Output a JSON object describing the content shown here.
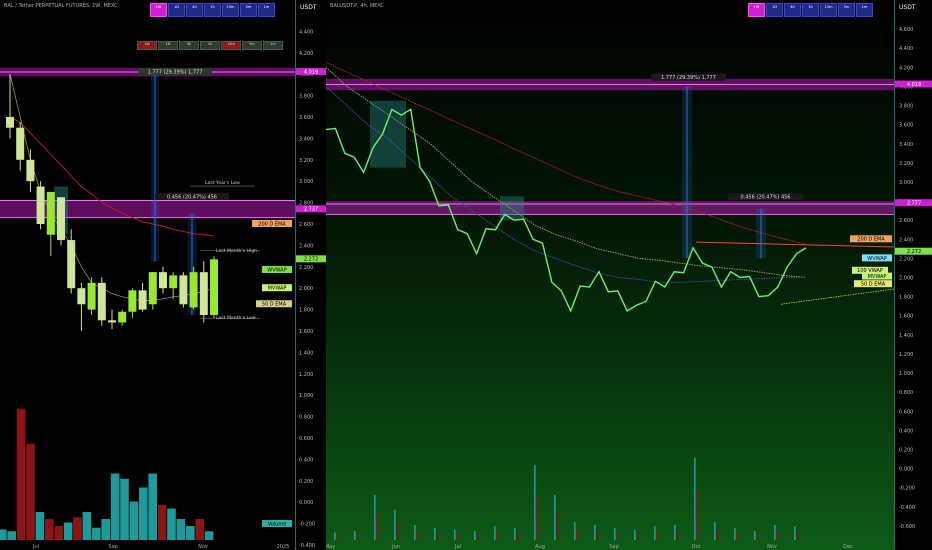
{
  "left": {
    "title": "BAL / Tether PERPETUAL FUTURES, 1W, MEXC",
    "unit": "USDT",
    "buttons": [
      "1W",
      "1D",
      "4h",
      "1h",
      "15m",
      "5m",
      "1m"
    ],
    "mini_tags": [
      "1W",
      "1D",
      "4h",
      "1h",
      "15m",
      "5m",
      "1m"
    ],
    "measure_label": "1.777 (29.39%) 1,777",
    "measure2_label": "0.456 (20.47%) 456",
    "last_year_low": "Last Year's Low",
    "last_month_high": "Last Month's High",
    "last_month_low": "Last Month's Low",
    "ema200": "200 D EMA",
    "wvwap": "WVWAP",
    "mvwap": "MVWAP",
    "ema50": "50 D EMA",
    "price_tag": "2.272",
    "top_tag": "4.019",
    "mid_tag": "2.737",
    "volume_label": "Volume",
    "x_ticks": [
      "Jul",
      "Sep",
      "Nov",
      "2025"
    ]
  },
  "right": {
    "title": "BALUSDT.P, 4h, MEXC",
    "unit": "USDT",
    "buttons": [
      "1W",
      "1D",
      "4h",
      "1h",
      "15m",
      "5m",
      "1m"
    ],
    "measure_label": "1.777 (29.39%) 1,777",
    "measure2_label": "0.456 (20.47%) 456",
    "ema200": "200 D EMA",
    "wvwap": "WVWAP",
    "mvwap": "MVWAP",
    "ema100": "100 VWAP",
    "ema50": "50 D EMA",
    "price_tag": "2.272",
    "top_tag": "4.019",
    "mid_tag": "2.777",
    "ema_tag": "2.398",
    "x_ticks": [
      "May",
      "Jun",
      "Jul",
      "Aug",
      "Sep",
      "Oct",
      "Nov",
      "Dec"
    ]
  },
  "colors": {
    "up": "#9be533",
    "down": "#cfe59a",
    "magenta": "#d01fd0",
    "blue_measure": "#2b6fd8",
    "vol_up": "#1f9a9a",
    "vol_down": "#8c1414",
    "ema200": "#b22020",
    "ema50": "#6b8a2a"
  },
  "chart_data": [
    {
      "type": "candlestick",
      "title": "BAL / Tether PERPETUAL FUTURES, 1W, MEXC",
      "ylabel": "USDT",
      "ylim": [
        -0.4,
        4.6
      ],
      "y_ticks": [
        4.4,
        4.2,
        4.0,
        3.8,
        3.6,
        3.4,
        3.2,
        3.0,
        2.8,
        2.6,
        2.4,
        2.2,
        2.0,
        1.8,
        1.6,
        1.4,
        1.2,
        1.0,
        0.8,
        0.6,
        0.4,
        0.2,
        0.0,
        -0.2,
        -0.4
      ],
      "candles": [
        {
          "o": 3.6,
          "h": 4.0,
          "l": 3.4,
          "c": 3.5
        },
        {
          "o": 3.5,
          "h": 3.55,
          "l": 3.1,
          "c": 3.2
        },
        {
          "o": 3.2,
          "h": 3.3,
          "l": 2.9,
          "c": 3.0
        },
        {
          "o": 2.95,
          "h": 3.0,
          "l": 2.55,
          "c": 2.6
        },
        {
          "o": 2.5,
          "h": 2.9,
          "l": 2.3,
          "c": 2.9
        },
        {
          "o": 2.85,
          "h": 2.85,
          "l": 2.4,
          "c": 2.45
        },
        {
          "o": 2.45,
          "h": 2.55,
          "l": 1.95,
          "c": 2.0
        },
        {
          "o": 2.0,
          "h": 2.05,
          "l": 1.6,
          "c": 1.85
        },
        {
          "o": 1.8,
          "h": 2.1,
          "l": 1.75,
          "c": 2.05
        },
        {
          "o": 2.05,
          "h": 2.1,
          "l": 1.65,
          "c": 1.7
        },
        {
          "o": 1.7,
          "h": 1.8,
          "l": 1.62,
          "c": 1.68
        },
        {
          "o": 1.68,
          "h": 1.8,
          "l": 1.65,
          "c": 1.78
        },
        {
          "o": 1.78,
          "h": 2.0,
          "l": 1.72,
          "c": 1.98
        },
        {
          "o": 1.98,
          "h": 2.05,
          "l": 1.78,
          "c": 1.8
        },
        {
          "o": 1.85,
          "h": 2.15,
          "l": 1.8,
          "c": 2.15
        },
        {
          "o": 2.15,
          "h": 2.2,
          "l": 1.95,
          "c": 2.0
        },
        {
          "o": 2.0,
          "h": 2.15,
          "l": 1.9,
          "c": 2.12
        },
        {
          "o": 2.12,
          "h": 2.15,
          "l": 1.82,
          "c": 1.85
        },
        {
          "o": 1.82,
          "h": 2.2,
          "l": 1.8,
          "c": 2.15
        },
        {
          "o": 2.15,
          "h": 2.25,
          "l": 1.68,
          "c": 1.75
        },
        {
          "o": 1.75,
          "h": 2.3,
          "l": 1.72,
          "c": 2.27
        }
      ],
      "volume": [
        {
          "v": 0.06,
          "up": true
        },
        {
          "v": 0.05,
          "up": true
        },
        {
          "v": 0.75,
          "up": false
        },
        {
          "v": 0.55,
          "up": false
        },
        {
          "v": 0.16,
          "up": true
        },
        {
          "v": 0.12,
          "up": false
        },
        {
          "v": 0.08,
          "up": false
        },
        {
          "v": 0.1,
          "up": true
        },
        {
          "v": 0.13,
          "up": false
        },
        {
          "v": 0.16,
          "up": true
        },
        {
          "v": 0.07,
          "up": true
        },
        {
          "v": 0.12,
          "up": true
        },
        {
          "v": 0.38,
          "up": true
        },
        {
          "v": 0.35,
          "up": true
        },
        {
          "v": 0.22,
          "up": true
        },
        {
          "v": 0.3,
          "up": true
        },
        {
          "v": 0.38,
          "up": true
        },
        {
          "v": 0.2,
          "up": false
        },
        {
          "v": 0.18,
          "up": true
        },
        {
          "v": 0.12,
          "up": true
        },
        {
          "v": 0.08,
          "up": true
        },
        {
          "v": 0.12,
          "up": false
        },
        {
          "v": 0.05,
          "up": true
        }
      ],
      "ema200": [
        3.6,
        3.55,
        3.45,
        3.35,
        3.25,
        3.15,
        3.05,
        2.95,
        2.88,
        2.8,
        2.75,
        2.7,
        2.66,
        2.62,
        2.6,
        2.58,
        2.55,
        2.53,
        2.51,
        2.5,
        2.49
      ],
      "ema50": [
        4.0,
        3.6,
        3.2,
        2.9,
        2.7,
        2.55,
        2.4,
        2.2,
        2.05,
        2.0,
        1.95,
        1.92,
        1.9,
        1.88,
        1.89,
        1.9,
        1.92,
        1.93,
        1.95,
        1.97,
        2.0
      ],
      "levels": {
        "top": 4.019,
        "zone": 2.737,
        "last_year_low": 2.955,
        "last_month_high": 2.35,
        "last_month_low": 1.72,
        "wvwap": 2.17,
        "mvwap": 2.0,
        "ema200_d": 2.6,
        "ema50_d": 1.95
      }
    },
    {
      "type": "line",
      "title": "BALUSDT.P, 4h, MEXC",
      "ylabel": "USDT",
      "ylim": [
        -0.8,
        4.8
      ],
      "y_ticks": [
        4.6,
        4.4,
        4.2,
        4.0,
        3.8,
        3.6,
        3.4,
        3.2,
        3.0,
        2.8,
        2.6,
        2.4,
        2.2,
        2.0,
        1.8,
        1.6,
        1.4,
        1.2,
        1.0,
        0.8,
        0.6,
        0.4,
        0.2,
        0.0,
        -0.2,
        -0.4,
        -0.6
      ],
      "price": [
        3.6,
        3.5,
        3.35,
        3.2,
        3.15,
        3.3,
        3.55,
        3.7,
        3.75,
        3.7,
        3.2,
        2.95,
        2.8,
        2.7,
        2.55,
        2.4,
        2.3,
        2.45,
        2.55,
        2.6,
        2.65,
        2.55,
        2.45,
        2.3,
        2.0,
        1.8,
        1.7,
        1.85,
        1.95,
        2.0,
        1.9,
        1.8,
        1.7,
        1.65,
        1.8,
        1.9,
        1.95,
        2.0,
        2.1,
        2.25,
        2.2,
        2.05,
        1.95,
        2.0,
        2.05,
        1.95,
        1.85,
        1.75,
        1.95,
        2.05,
        2.3,
        2.25
      ],
      "ema200": [
        4.25,
        4.15,
        4.05,
        3.95,
        3.85,
        3.75,
        3.65,
        3.55,
        3.45,
        3.35,
        3.25,
        3.15,
        3.05,
        2.97,
        2.9,
        2.85,
        2.8,
        2.75,
        2.68,
        2.6,
        2.52,
        2.46,
        2.4,
        2.35
      ],
      "ema100": [
        4.2,
        4.0,
        3.85,
        3.7,
        3.55,
        3.4,
        3.2,
        3.0,
        2.85,
        2.7,
        2.55,
        2.45,
        2.38,
        2.3,
        2.25,
        2.2,
        2.18,
        2.15,
        2.12,
        2.1,
        2.08,
        2.05,
        2.02,
        2.0
      ],
      "ema50": [
        4.0,
        3.8,
        3.6,
        3.45,
        3.25,
        3.05,
        2.85,
        2.7,
        2.55,
        2.4,
        2.28,
        2.2,
        2.12,
        2.05,
        2.0,
        1.98,
        1.95,
        1.95,
        1.96,
        1.97,
        1.98,
        1.99,
        2.0,
        2.0
      ],
      "volume_spikes": [
        0.05,
        0.06,
        0.3,
        0.2,
        0.1,
        0.08,
        0.07,
        0.06,
        0.09,
        0.08,
        0.5,
        0.3,
        0.12,
        0.1,
        0.08,
        0.07,
        0.09,
        0.1,
        0.55,
        0.12,
        0.08,
        0.06,
        0.1,
        0.09
      ],
      "levels": {
        "top": 4.019,
        "zone": 2.777,
        "ema200_d": 2.398,
        "wvwap": 2.17,
        "mvwap": 2.0,
        "ema50_d": 1.93
      }
    }
  ]
}
